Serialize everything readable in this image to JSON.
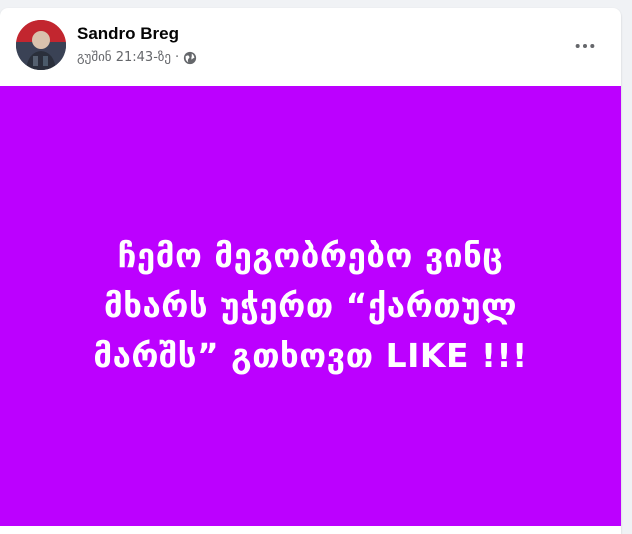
{
  "post": {
    "author": "Sandro Breg",
    "timestamp": "გუშინ 21:43-ზე",
    "separator": "·",
    "privacy_icon": "globe-icon",
    "more_icon": "more-dots-icon",
    "image_text": "ჩემო მეგობრებო ვინც მხარს უჭერთ “ქართულ მარშს” გთხოვთ LIKE !!!",
    "image_background": "#bc00ff",
    "image_text_color": "#ffffff"
  }
}
